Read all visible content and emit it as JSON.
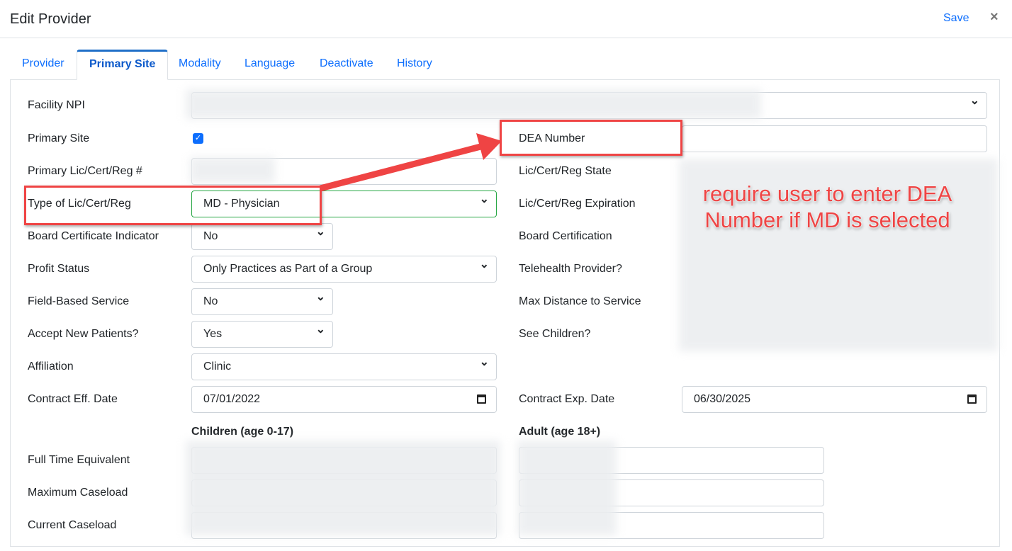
{
  "header": {
    "title": "Edit Provider",
    "save_label": "Save",
    "close_label": "×"
  },
  "tabs": [
    {
      "label": "Provider"
    },
    {
      "label": "Primary Site",
      "active": true
    },
    {
      "label": "Modality"
    },
    {
      "label": "Language"
    },
    {
      "label": "Deactivate"
    },
    {
      "label": "History"
    }
  ],
  "form": {
    "facility_npi": {
      "label": "Facility NPI"
    },
    "primary_site": {
      "label": "Primary Site",
      "checked": true
    },
    "primary_lic": {
      "label": "Primary Lic/Cert/Reg #"
    },
    "type_lic": {
      "label": "Type of Lic/Cert/Reg",
      "value": "MD - Physician"
    },
    "board_cert_ind": {
      "label": "Board Certificate Indicator",
      "value": "No"
    },
    "profit_status": {
      "label": "Profit Status",
      "value": "Only Practices as Part of a Group"
    },
    "field_based": {
      "label": "Field-Based Service",
      "value": "No"
    },
    "accept_new": {
      "label": "Accept New Patients?",
      "value": "Yes"
    },
    "affiliation": {
      "label": "Affiliation",
      "value": "Clinic"
    },
    "contract_eff": {
      "label": "Contract Eff. Date",
      "value": "07/01/2022"
    },
    "dea": {
      "label": "DEA Number",
      "value": ""
    },
    "lic_state": {
      "label": "Lic/Cert/Reg State"
    },
    "lic_exp": {
      "label": "Lic/Cert/Reg Expiration"
    },
    "board_cert": {
      "label": "Board Certification"
    },
    "telehealth": {
      "label": "Telehealth Provider?"
    },
    "max_distance": {
      "label": "Max Distance to Service"
    },
    "see_children": {
      "label": "See Children?"
    },
    "contract_exp": {
      "label": "Contract Exp. Date",
      "value": "06/30/2025"
    },
    "children_header": "Children (age 0-17)",
    "adult_header": "Adult (age 18+)",
    "fte": {
      "label": "Full Time Equivalent"
    },
    "max_caseload": {
      "label": "Maximum Caseload"
    },
    "current_caseload": {
      "label": "Current Caseload"
    }
  },
  "annotation": {
    "text": "require user to enter DEA Number if MD is selected",
    "color": "#ef4444"
  }
}
